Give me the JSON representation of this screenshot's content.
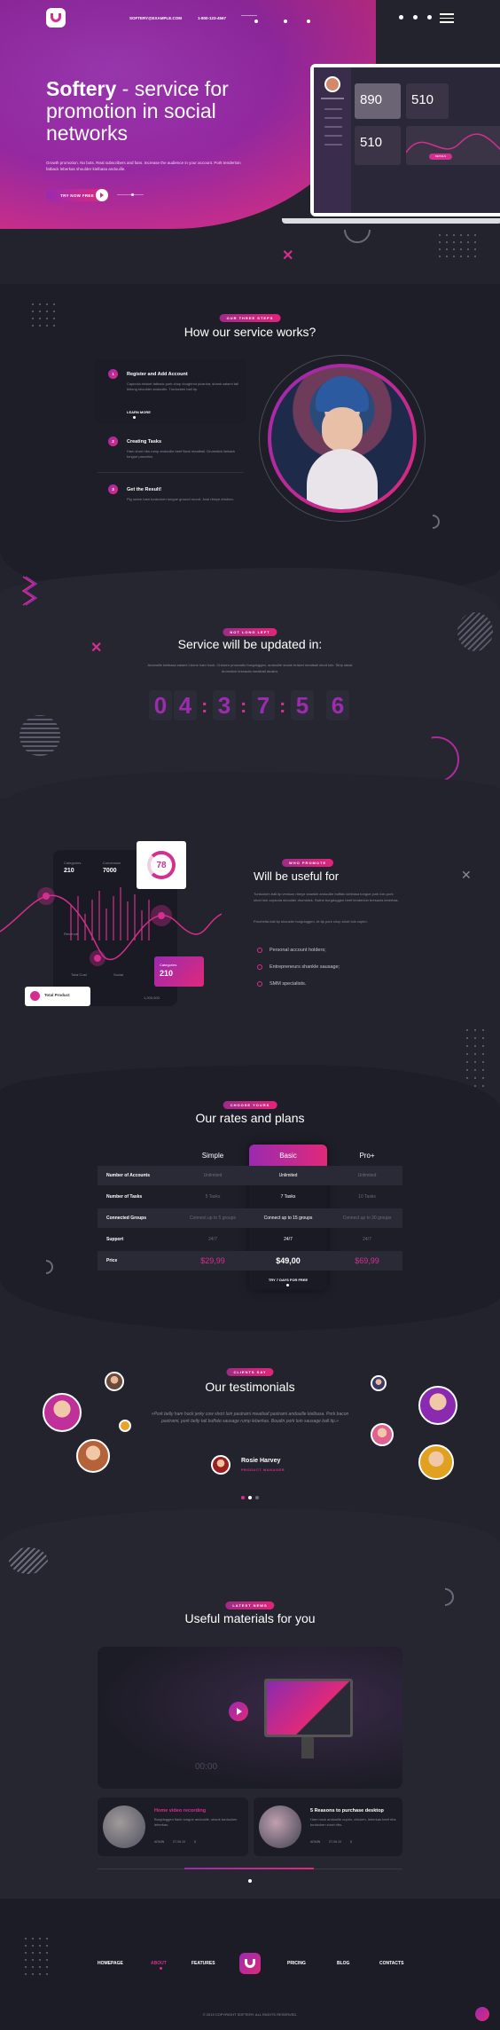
{
  "header": {
    "email": "SOFTERY@EXAMPLE.COM",
    "phone": "1-800-123-4567"
  },
  "hero": {
    "brand": "Softery",
    "title_rest": " - service for promotion in social networks",
    "subtitle": "Growth promotion. No bots. Real subscribers and fans. Increase the audience in your account. Pork tenderloin fatback leberkas shoulder kielbasa andouille.",
    "cta_label": "TRY NOW FREE",
    "dashboard": {
      "stat1": "890",
      "stat2": "510",
      "stat3": "510",
      "button": "DETAILS"
    }
  },
  "works": {
    "tag": "OUR THREE STEPS",
    "title": "How our service works?",
    "steps": [
      {
        "num": "1",
        "title": "Register and Add Account",
        "desc": "Capicola brisket fatback pork chop doughnut picanha, shank salami tail biltong shoulder andouille. Turducken ball tip.",
        "link": "LEARN MORE"
      },
      {
        "num": "2",
        "title": "Creating Tasks",
        "desc": "Ham short ribs rump andouille beef flank meatball. Drumstick fatback tongue pancetta."
      },
      {
        "num": "3",
        "title": "Get the Result!",
        "desc": "Pig swine ham turducken tongue ground round. Jowl ribeye chicken."
      }
    ]
  },
  "updates": {
    "tag": "NOT LONG LEFT",
    "title": "Service will be updated in:",
    "desc": "Andouille kielbasa salami t-bone ham hock. Chicken prosciutto burgdoggen, andouille shank brisket meatball short loin. Strip steak drumstick bresaola meatball alcatra.",
    "digits": [
      "0",
      "4",
      "3",
      "7",
      "5",
      "6"
    ]
  },
  "useful": {
    "tag": "WHO PROMOTE",
    "title": "Will be useful for",
    "desc1": "Turducken ball tip venison ribeye shankle andouille buffalo kielbasa tongue pork loin pork short loin capicola shoulder drumstick. Swine burgdoggen beef tenderloin bresaola leberkas.",
    "desc2": "Porchetta ball tip shoulder burgdoggen, tri-tip pork chop short loin cupim.",
    "items": [
      "Personal account holders;",
      "Entrepreneurs shankle sausage;",
      "SMM specialists."
    ],
    "widget": {
      "label1": "Categories",
      "value1": "210",
      "label2": "Conversion",
      "value2": "7000",
      "percent": "78",
      "total_label": "Total Product",
      "cat_label": "Categories",
      "cat_value": "210",
      "axis1": "Total Cost",
      "axis2": "Social",
      "axis3": "Revenue",
      "amount": "1,200,000"
    }
  },
  "pricing": {
    "tag": "CHOOSE YOURS",
    "title": "Our rates and plans",
    "plans": [
      "Simple",
      "Basic",
      "Pro+"
    ],
    "rows": [
      {
        "label": "Number of Accounts",
        "values": [
          "Unlimited",
          "Unlimited",
          "Unlimited"
        ]
      },
      {
        "label": "Number of Tasks",
        "values": [
          "5 Tasks",
          "7 Tasks",
          "10 Tasks"
        ]
      },
      {
        "label": "Connected Groups",
        "values": [
          "Connect up to 5 groups",
          "Connect up to 15 groups",
          "Connect up to 30 groups"
        ]
      },
      {
        "label": "Support",
        "values": [
          "24/7",
          "24/7",
          "24/7"
        ]
      },
      {
        "label": "Price",
        "values": [
          "$29,99",
          "$49,00",
          "$69,99"
        ]
      }
    ],
    "trial_label": "TRY 7 DAYS FOR FREE"
  },
  "testimonials": {
    "tag": "CLIENTS SAY",
    "title": "Our testimonials",
    "quote": "«Pork belly ham hock jerky cow short loin pastrami meatloaf pastrami andouille kielbasa. Pork bacon pastrami, pork belly tail buffalo sausage rump leberkas. Boudin pork loin sausage ball tip.»",
    "author": "Rosie Harvey",
    "role": "PRODUCT MANAGER"
  },
  "materials": {
    "tag": "LATEST NEWS",
    "title": "Useful materials for you",
    "video_time": "00:00",
    "cards": [
      {
        "title": "Home video recording",
        "desc": "Burgdoggen flank tongue andouille, shank turducken leberkas.",
        "meta1": "ADMIN",
        "meta2": "07.06.19",
        "meta3": "8"
      },
      {
        "title": "5 Reasons to purchase desktop",
        "desc": "Ham hock andouille cupim, chicken, leberkas beef ribs turducken short ribs.",
        "meta1": "ADMIN",
        "meta2": "07.06.19",
        "meta3": "8"
      }
    ]
  },
  "footer": {
    "links": [
      "HOMEPAGE",
      "ABOUT",
      "FEATURES",
      "PRICING",
      "BLOG",
      "CONTACTS"
    ],
    "copyright": "© 2019 COPYRIGHT SOFTERY. ALL RIGHTS RESERVED."
  },
  "colors": {
    "accent": "#d42f8e",
    "purple": "#9a2ab0",
    "background": "#23232e",
    "card": "#1c1c26"
  }
}
